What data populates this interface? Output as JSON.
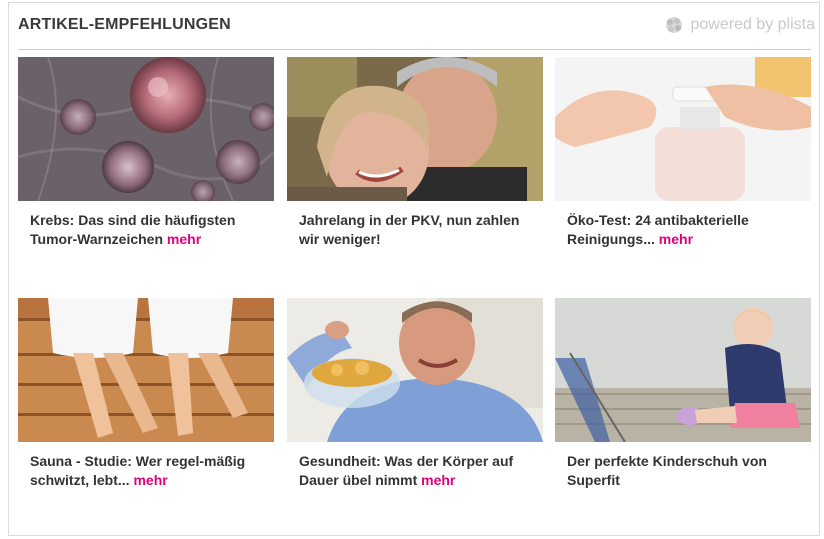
{
  "header": {
    "title": "ARTIKEL-EMPFEHLUNGEN",
    "powered_by": "powered by plista"
  },
  "articles": [
    {
      "title": "Krebs: Das sind die häufigsten Tumor-Warnzeichen",
      "more": "mehr",
      "image": "cancer-cells-image"
    },
    {
      "title": "Jahrelang in der PKV, nun zahlen wir weniger!",
      "more": "",
      "image": "senior-couple-image"
    },
    {
      "title": "Öko-Test: 24 antibakterielle Reinigungs...",
      "more": "mehr",
      "image": "soap-dispenser-hands-image"
    },
    {
      "title": "Sauna - Studie: Wer regel-mäßig schwitzt, lebt...",
      "more": "mehr",
      "image": "sauna-legs-image"
    },
    {
      "title": "Gesundheit: Was der Körper auf Dauer übel nimmt",
      "more": "mehr",
      "image": "man-eating-chips-image"
    },
    {
      "title": "Der perfekte Kinderschuh von Superfit",
      "more": "",
      "image": "toddler-sitting-image"
    }
  ]
}
